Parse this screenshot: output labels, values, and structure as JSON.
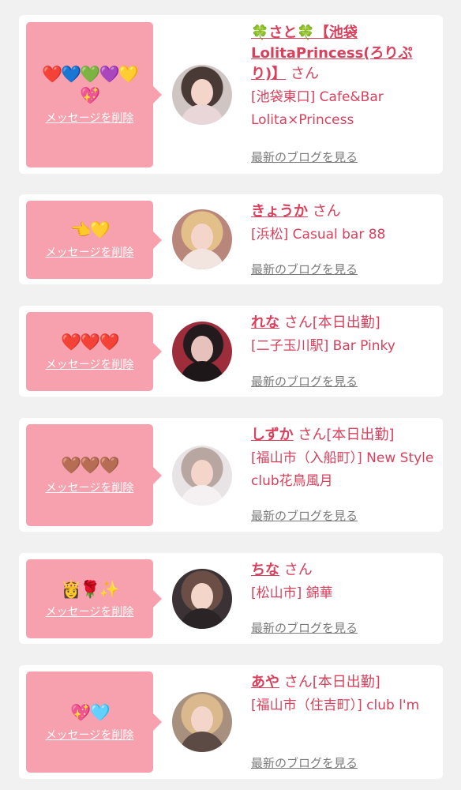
{
  "delete_label": "メッセージを削除",
  "blog_label": "最新のブログを見る",
  "colors": {
    "accent": "#d8405c",
    "bubble": "#f7a0ae",
    "background": "#f1f1f1"
  },
  "messages": [
    {
      "message": "❤️💙💚💜💛💖",
      "name": "🍀さと🍀【池袋LolitaPrincess(ろりぷり)】",
      "suffix": "さん",
      "shop": "[池袋東口] Cafe&Bar Lolita×Princess"
    },
    {
      "message": "👈💛",
      "name": "きょうか",
      "suffix": "さん",
      "shop": "[浜松] Casual bar 88"
    },
    {
      "message": "❤️❤️❤️",
      "name": "れな",
      "suffix": "さん[本日出勤]",
      "shop": "[二子玉川駅] Bar Pinky"
    },
    {
      "message": "🤎🤎🤎",
      "name": "しずか",
      "suffix": "さん[本日出勤]",
      "shop": "[福山市（入船町）] New Style club花鳥風月"
    },
    {
      "message": "👸🌹✨",
      "name": "ちな",
      "suffix": "さん",
      "shop": "[松山市] 錦華"
    },
    {
      "message": "💖🩵",
      "name": "あや",
      "suffix": "さん[本日出勤]",
      "shop": "[福山市（住吉町）] club l'm"
    }
  ]
}
